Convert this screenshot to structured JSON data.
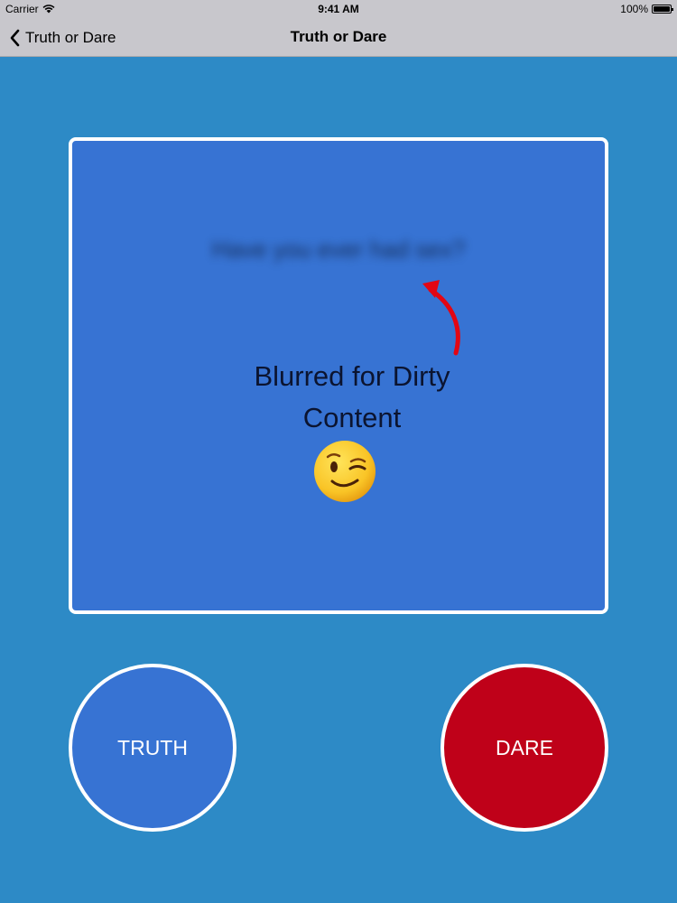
{
  "status_bar": {
    "carrier": "Carrier",
    "time": "9:41 AM",
    "battery": "100%"
  },
  "nav": {
    "back_label": "Truth or Dare",
    "title": "Truth or Dare"
  },
  "card": {
    "question": "Have you ever had sex?",
    "annotation": "Blurred for Dirty Content",
    "emoji": "winking-face"
  },
  "buttons": {
    "truth": "TRUTH",
    "dare": "DARE"
  },
  "colors": {
    "background": "#2d8ac6",
    "card": "#3773d3",
    "truth": "#3773d3",
    "dare": "#bf0119",
    "annotation_arrow": "#e30613"
  }
}
